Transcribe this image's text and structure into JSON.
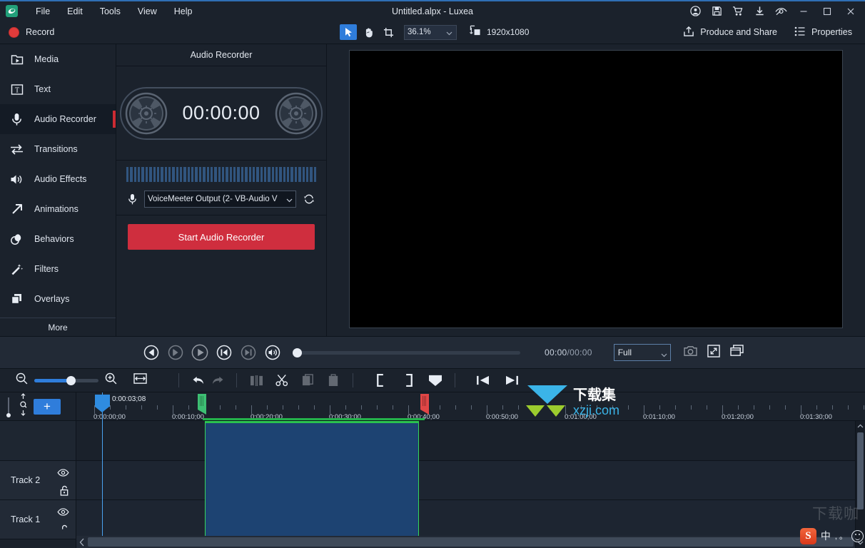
{
  "window": {
    "title": "Untitled.alpx - Luxea",
    "logo_icon": "luxea-logo-icon",
    "minimize_icon": "minimize-icon",
    "maximize_icon": "maximize-icon",
    "close_icon": "close-icon"
  },
  "menubar": {
    "items": [
      {
        "label": "File",
        "name": "menu-file"
      },
      {
        "label": "Edit",
        "name": "menu-edit"
      },
      {
        "label": "Tools",
        "name": "menu-tools"
      },
      {
        "label": "View",
        "name": "menu-view"
      },
      {
        "label": "Help",
        "name": "menu-help"
      }
    ]
  },
  "titlebar_icons": [
    {
      "name": "account-icon",
      "glyph": "account"
    },
    {
      "name": "save-icon",
      "glyph": "save"
    },
    {
      "name": "cart-icon",
      "glyph": "cart"
    },
    {
      "name": "download-icon",
      "glyph": "download"
    },
    {
      "name": "eye-brush-icon",
      "glyph": "eyecare"
    }
  ],
  "toolbar": {
    "record_label": "Record",
    "record_icon": "record-dot-icon",
    "select_tool_icon": "cursor-arrow-icon",
    "hand_tool_icon": "hand-icon",
    "crop_tool_icon": "crop-icon",
    "zoom_value": "36.1%",
    "resolution_icon": "resolution-icon",
    "resolution": "1920x1080",
    "produce_label": "Produce and Share",
    "produce_icon": "share-upload-icon",
    "properties_label": "Properties",
    "properties_icon": "list-icon"
  },
  "sidebar": {
    "items": [
      {
        "label": "Media",
        "icon": "media-folder-icon",
        "selected": false
      },
      {
        "label": "Text",
        "icon": "text-icon",
        "selected": false
      },
      {
        "label": "Audio Recorder",
        "icon": "microphone-icon",
        "selected": true
      },
      {
        "label": "Transitions",
        "icon": "transitions-arrows-icon",
        "selected": false
      },
      {
        "label": "Audio Effects",
        "icon": "speaker-icon",
        "selected": false
      },
      {
        "label": "Animations",
        "icon": "arrow-diagonal-icon",
        "selected": false
      },
      {
        "label": "Behaviors",
        "icon": "behaviors-circles-icon",
        "selected": false
      },
      {
        "label": "Filters",
        "icon": "magic-wand-icon",
        "selected": false
      },
      {
        "label": "Overlays",
        "icon": "overlays-squares-icon",
        "selected": false
      }
    ],
    "more_label": "More"
  },
  "recorder_panel": {
    "title": "Audio Recorder",
    "timer": "00:00:00",
    "reel_icon": "tape-reel-icon",
    "mic_icon": "microphone-small-icon",
    "device": "VoiceMeeter Output (2- VB-Audio V",
    "refresh_icon": "refresh-icon",
    "start_label": "Start Audio Recorder"
  },
  "player": {
    "controls": [
      {
        "name": "step-back-button",
        "icon": "frame-back-icon",
        "enabled": true
      },
      {
        "name": "step-forward-button",
        "icon": "frame-forward-icon",
        "enabled": false
      },
      {
        "name": "play-button",
        "icon": "play-icon",
        "enabled": true
      },
      {
        "name": "prev-marker-button",
        "icon": "skip-start-icon",
        "enabled": true
      },
      {
        "name": "next-marker-button",
        "icon": "skip-end-icon",
        "enabled": false
      },
      {
        "name": "volume-button",
        "icon": "volume-icon",
        "enabled": true
      }
    ],
    "current_time": "00:00",
    "separator": "/",
    "total_time": "00:00",
    "quality": "Full",
    "snapshot_icon": "camera-icon",
    "fullscreen_icon": "expand-icon",
    "detach_icon": "detach-window-icon"
  },
  "timeline_toolbar": {
    "zoom_out_icon": "zoom-out-icon",
    "zoom_in_icon": "zoom-in-icon",
    "fit_icon": "fit-timeline-icon",
    "undo_icon": "undo-icon",
    "redo_icon": "redo-icon",
    "split_icon": "split-icon",
    "cut_icon": "scissors-icon",
    "copy_icon": "copy-icon",
    "paste_icon": "paste-icon",
    "mark_in_icon": "mark-in-icon",
    "mark_out_icon": "mark-out-icon",
    "marker_icon": "marker-icon",
    "goto_start_icon": "go-to-start-icon",
    "goto_end_icon": "go-to-end-icon"
  },
  "timeline": {
    "add_track_label": "+",
    "zoom_vertical_icon": "vertical-zoom-icon",
    "playhead_time": "0:00:03;08",
    "ruler_labels": [
      "0:00:00;00",
      "0:00:10;00",
      "0:00:20;00",
      "0:00:30;00",
      "0:00:40;00",
      "0:00:50;00",
      "0:01:00;00",
      "0:01:10;00",
      "0:01:20;00",
      "0:01:30;00"
    ],
    "mark_in_time": "0:00:17;00",
    "mark_out_time": "0:00:45;00",
    "tracks": [
      {
        "label": "Track 2",
        "eye_icon": "eye-icon",
        "lock_icon": "unlock-icon"
      },
      {
        "label": "Track 1",
        "eye_icon": "eye-icon",
        "lock_icon": "unlock-icon"
      }
    ],
    "clip": {
      "name": "timeline-clip"
    },
    "colors": {
      "accent": "#2f7ddb",
      "record": "#cf2e3e",
      "mark_in": "#3dbf73",
      "mark_out": "#e04646",
      "clip": "#1d4372"
    }
  },
  "watermark": {
    "text_cn": "下载集",
    "text_url": "xzji.com",
    "secondary": "下载咖"
  },
  "ime": {
    "logo": "S",
    "mode": "中",
    "punct": ", 。",
    "emoji_icon": "smiley-icon"
  }
}
